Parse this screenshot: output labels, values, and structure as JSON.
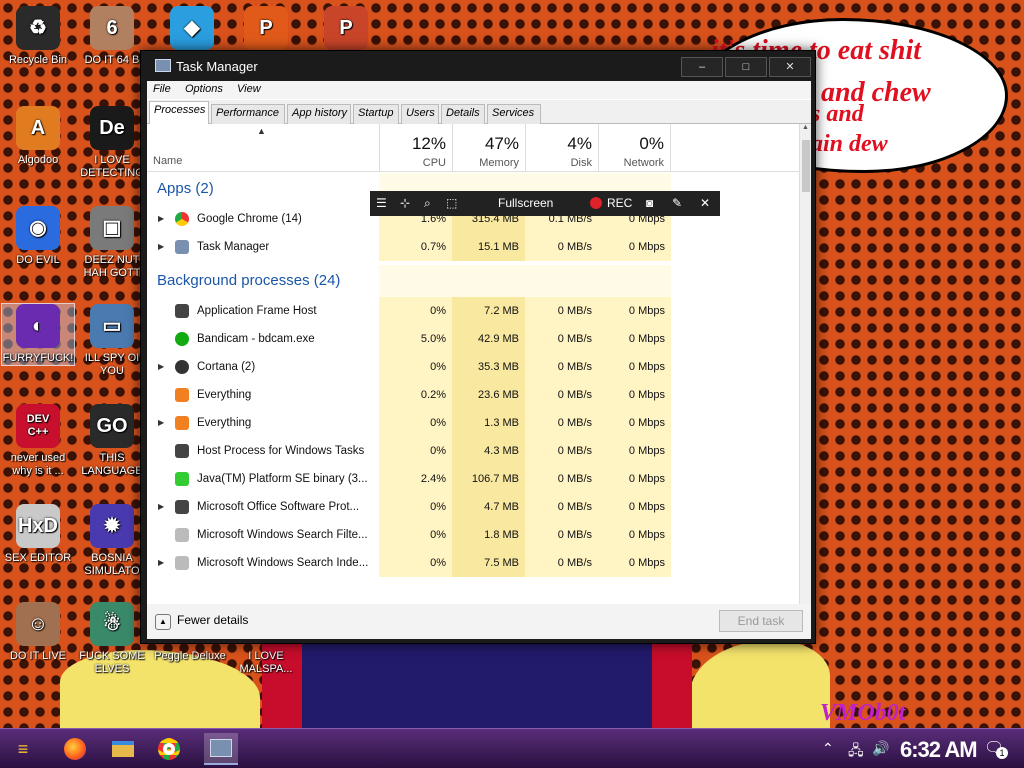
{
  "wallpaper": {
    "speech_lines": [
      "it's time to eat shit",
      "and chew",
      "s and",
      "ain dew"
    ],
    "signature": "VMOb0t"
  },
  "desktop_icons": [
    {
      "id": "recycle-bin",
      "label": "Recycle Bin",
      "glyph": "♻",
      "color": "#2a2a2a"
    },
    {
      "id": "do-it-64",
      "label": "DO IT 64 B",
      "glyph": "6",
      "color": "#b08060"
    },
    {
      "id": "diamond",
      "label": "",
      "glyph": "◆",
      "color": "#2b9ee0"
    },
    {
      "id": "peggle-p",
      "label": "",
      "glyph": "P",
      "color": "#e25a1a"
    },
    {
      "id": "powerpoint",
      "label": "",
      "glyph": "P",
      "color": "#c9452a"
    },
    {
      "id": "algodoo",
      "label": "Algodoo",
      "glyph": "A",
      "color": "#e07b20"
    },
    {
      "id": "i-love-detecting",
      "label": "I LOVE DETECTING",
      "glyph": "De",
      "color": "#1a1a1a"
    },
    {
      "id": "do-evil",
      "label": "DO EVIL",
      "glyph": "◉",
      "color": "#2a6be0"
    },
    {
      "id": "deez-nuts",
      "label": "DEEZ NUT HAH GOTT",
      "glyph": "▣",
      "color": "#7a7a7a"
    },
    {
      "id": "furryfuck",
      "label": "FURRYFUCK!",
      "glyph": "◐",
      "color": "#6a2bb0"
    },
    {
      "id": "ill-spy",
      "label": "ILL SPY OI YOU",
      "glyph": "▭",
      "color": "#4a7ab0"
    },
    {
      "id": "dev-cpp",
      "label": "never used why is it ...",
      "glyph": "DEV C++",
      "color": "#c8102e"
    },
    {
      "id": "go-lang",
      "label": "THIS LANGUAGE",
      "glyph": "GO",
      "color": "#2a2a2a"
    },
    {
      "id": "hxd",
      "label": "SEX EDITOR",
      "glyph": "HxD",
      "color": "#c9c9c9"
    },
    {
      "id": "bosnia",
      "label": "BOSNIA SIMULATO",
      "glyph": "✹",
      "color": "#4a3ab0"
    },
    {
      "id": "do-it-live",
      "label": "DO IT LIVE",
      "glyph": "☺",
      "color": "#a07050"
    },
    {
      "id": "elves",
      "label": "FUCK SOME ELVES",
      "glyph": "☃",
      "color": "#3a8a6a"
    },
    {
      "id": "peggle-deluxe",
      "label": "Peggle Deluxe",
      "glyph": "",
      "color": "transparent"
    },
    {
      "id": "malspa",
      "label": "I LOVE MALSPA...",
      "glyph": "",
      "color": "transparent"
    }
  ],
  "task_manager": {
    "title": "Task Manager",
    "window_buttons": [
      "–",
      "□",
      "✕"
    ],
    "menu": [
      "File",
      "Options",
      "View"
    ],
    "tabs": [
      "Processes",
      "Performance",
      "App history",
      "Startup",
      "Users",
      "Details",
      "Services"
    ],
    "active_tab": "Processes",
    "columns": {
      "name": "Name",
      "cpu": {
        "pct": "12%",
        "label": "CPU"
      },
      "memory": {
        "pct": "47%",
        "label": "Memory"
      },
      "disk": {
        "pct": "4%",
        "label": "Disk"
      },
      "network": {
        "pct": "0%",
        "label": "Network"
      }
    },
    "groups": [
      {
        "title": "Apps (2)"
      },
      {
        "title": "Background processes (24)"
      }
    ],
    "apps": [
      {
        "name": "Google Chrome (14)",
        "expand": true,
        "icon": "chrome",
        "cpu": "1.6%",
        "mem": "315.4 MB",
        "disk": "0.1 MB/s",
        "net": "0 Mbps"
      },
      {
        "name": "Task Manager",
        "expand": true,
        "icon": "taskmgr",
        "cpu": "0.7%",
        "mem": "15.1 MB",
        "disk": "0 MB/s",
        "net": "0 Mbps"
      }
    ],
    "background": [
      {
        "name": "Application Frame Host",
        "expand": false,
        "icon": "app",
        "cpu": "0%",
        "mem": "7.2 MB",
        "disk": "0 MB/s",
        "net": "0 Mbps"
      },
      {
        "name": "Bandicam - bdcam.exe",
        "expand": false,
        "icon": "bandicam",
        "cpu": "5.0%",
        "mem": "42.9 MB",
        "disk": "0 MB/s",
        "net": "0 Mbps"
      },
      {
        "name": "Cortana (2)",
        "expand": true,
        "icon": "cortana",
        "cpu": "0%",
        "mem": "35.3 MB",
        "disk": "0 MB/s",
        "net": "0 Mbps"
      },
      {
        "name": "Everything",
        "expand": false,
        "icon": "search",
        "cpu": "0.2%",
        "mem": "23.6 MB",
        "disk": "0 MB/s",
        "net": "0 Mbps"
      },
      {
        "name": "Everything",
        "expand": true,
        "icon": "search",
        "cpu": "0%",
        "mem": "1.3 MB",
        "disk": "0 MB/s",
        "net": "0 Mbps"
      },
      {
        "name": "Host Process for Windows Tasks",
        "expand": false,
        "icon": "app",
        "cpu": "0%",
        "mem": "4.3 MB",
        "disk": "0 MB/s",
        "net": "0 Mbps"
      },
      {
        "name": "Java(TM) Platform SE binary (3...",
        "expand": false,
        "icon": "java",
        "cpu": "2.4%",
        "mem": "106.7 MB",
        "disk": "0 MB/s",
        "net": "0 Mbps"
      },
      {
        "name": "Microsoft Office Software Prot...",
        "expand": true,
        "icon": "app",
        "cpu": "0%",
        "mem": "4.7 MB",
        "disk": "0 MB/s",
        "net": "0 Mbps"
      },
      {
        "name": "Microsoft Windows Search Filte...",
        "expand": false,
        "icon": "user",
        "cpu": "0%",
        "mem": "1.8 MB",
        "disk": "0 MB/s",
        "net": "0 Mbps"
      },
      {
        "name": "Microsoft Windows Search Inde...",
        "expand": true,
        "icon": "user",
        "cpu": "0%",
        "mem": "7.5 MB",
        "disk": "0 MB/s",
        "net": "0 Mbps"
      }
    ],
    "fewer_details": "Fewer details",
    "end_task": "End task"
  },
  "recorder_bar": {
    "mode": "Fullscreen",
    "rec_label": "REC"
  },
  "taskbar": {
    "clock": "6:32 AM",
    "notification_count": "1",
    "pinned": [
      "start",
      "firefox",
      "file-explorer",
      "chrome",
      "task-manager"
    ]
  },
  "colors": {
    "accent_blue": "#1a56a8",
    "heat_light": "#fff4c4",
    "heat_medium": "#f9e8a0",
    "rec_red": "#e0202a"
  }
}
